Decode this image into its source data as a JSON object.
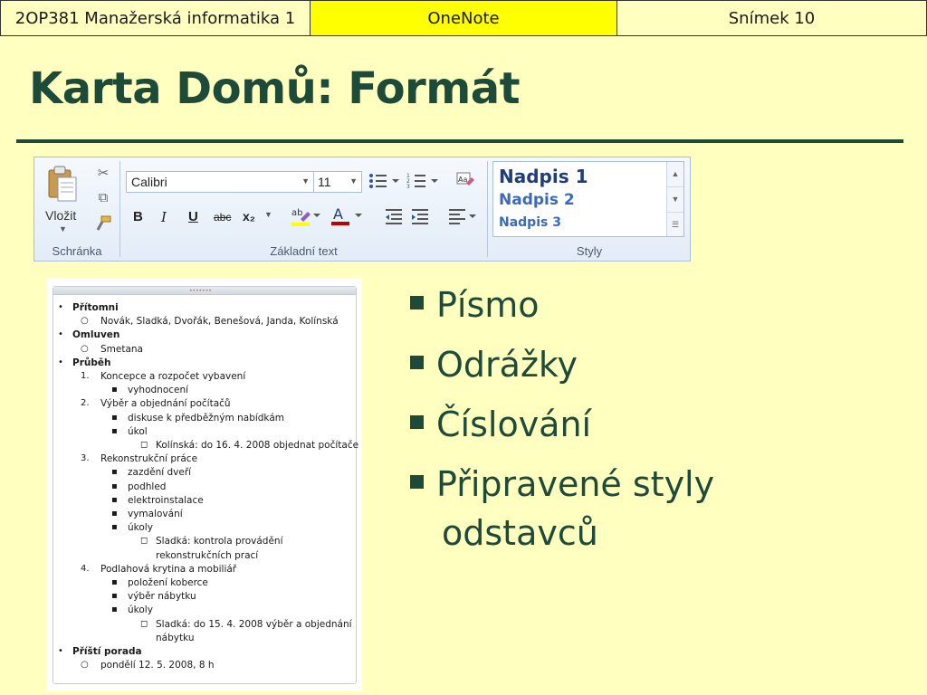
{
  "header": {
    "course": "2OP381 Manažerská informatika 1",
    "app": "OneNote",
    "slide": "Snímek 10"
  },
  "title": "Karta Domů: Formát",
  "ribbon": {
    "paste_label": "Vložit",
    "clipboard_label": "Schránka",
    "basic_text_label": "Základní text",
    "styles_label": "Styly",
    "font_name": "Calibri",
    "font_size": "11",
    "bold": "B",
    "italic": "I",
    "underline": "U",
    "strike": "abc",
    "subscript": "x₂",
    "styles": [
      "Nadpis 1",
      "Nadpis 2",
      "Nadpis 3"
    ]
  },
  "notes": [
    {
      "marker": "•",
      "text": "Přítomni",
      "bold": true,
      "level": 0
    },
    {
      "marker": "○",
      "text": "Novák, Sladká, Dvořák, Benešová, Janda, Kolínská",
      "bold": false,
      "level": 1
    },
    {
      "marker": "•",
      "text": "Omluven",
      "bold": true,
      "level": 0
    },
    {
      "marker": "○",
      "text": "Smetana",
      "bold": false,
      "level": 1
    },
    {
      "marker": "•",
      "text": "Průběh",
      "bold": true,
      "level": 0
    },
    {
      "marker": "1.",
      "text": "Koncepce a rozpočet vybavení",
      "bold": false,
      "level": 1
    },
    {
      "marker": "▪",
      "text": "vyhodnocení",
      "bold": false,
      "level": 2
    },
    {
      "marker": "2.",
      "text": "Výběr a objednání počítačů",
      "bold": false,
      "level": 1
    },
    {
      "marker": "▪",
      "text": "diskuse k předběžným nabídkám",
      "bold": false,
      "level": 2
    },
    {
      "marker": "▪",
      "text": "úkol",
      "bold": false,
      "level": 2
    },
    {
      "marker": "◻",
      "text": "Kolínská: do 16. 4. 2008 objednat počítače",
      "bold": false,
      "level": 3
    },
    {
      "marker": "3.",
      "text": "Rekonstrukční práce",
      "bold": false,
      "level": 1
    },
    {
      "marker": "▪",
      "text": "zazdění dveří",
      "bold": false,
      "level": 2
    },
    {
      "marker": "▪",
      "text": "podhled",
      "bold": false,
      "level": 2
    },
    {
      "marker": "▪",
      "text": "elektroinstalace",
      "bold": false,
      "level": 2
    },
    {
      "marker": "▪",
      "text": "vymalování",
      "bold": false,
      "level": 2
    },
    {
      "marker": "▪",
      "text": "úkoly",
      "bold": false,
      "level": 2
    },
    {
      "marker": "◻",
      "text": "Sladká: kontrola provádění",
      "bold": false,
      "level": 3
    },
    {
      "marker": "",
      "text": "rekonstrukčních prací",
      "bold": false,
      "level": 3
    },
    {
      "marker": "4.",
      "text": "Podlahová krytina a mobiliář",
      "bold": false,
      "level": 1
    },
    {
      "marker": "▪",
      "text": "položení koberce",
      "bold": false,
      "level": 2
    },
    {
      "marker": "▪",
      "text": "výběr nábytku",
      "bold": false,
      "level": 2
    },
    {
      "marker": "▪",
      "text": "úkoly",
      "bold": false,
      "level": 2
    },
    {
      "marker": "◻",
      "text": "Sladká: do 15. 4. 2008 výběr a objednání",
      "bold": false,
      "level": 3
    },
    {
      "marker": "",
      "text": "nábytku",
      "bold": false,
      "level": 3
    },
    {
      "marker": "•",
      "text": "Příští porada",
      "bold": true,
      "level": 0
    },
    {
      "marker": "○",
      "text": "pondělí 12. 5. 2008, 8 h",
      "bold": false,
      "level": 1
    }
  ],
  "bullets": [
    "Písmo",
    "Odrážky",
    "Číslování",
    "Připravené styly",
    "odstavců"
  ],
  "colors": {
    "background": "#ffffc0",
    "accent": "#1e4a3a",
    "highlight": "#ffff00"
  }
}
